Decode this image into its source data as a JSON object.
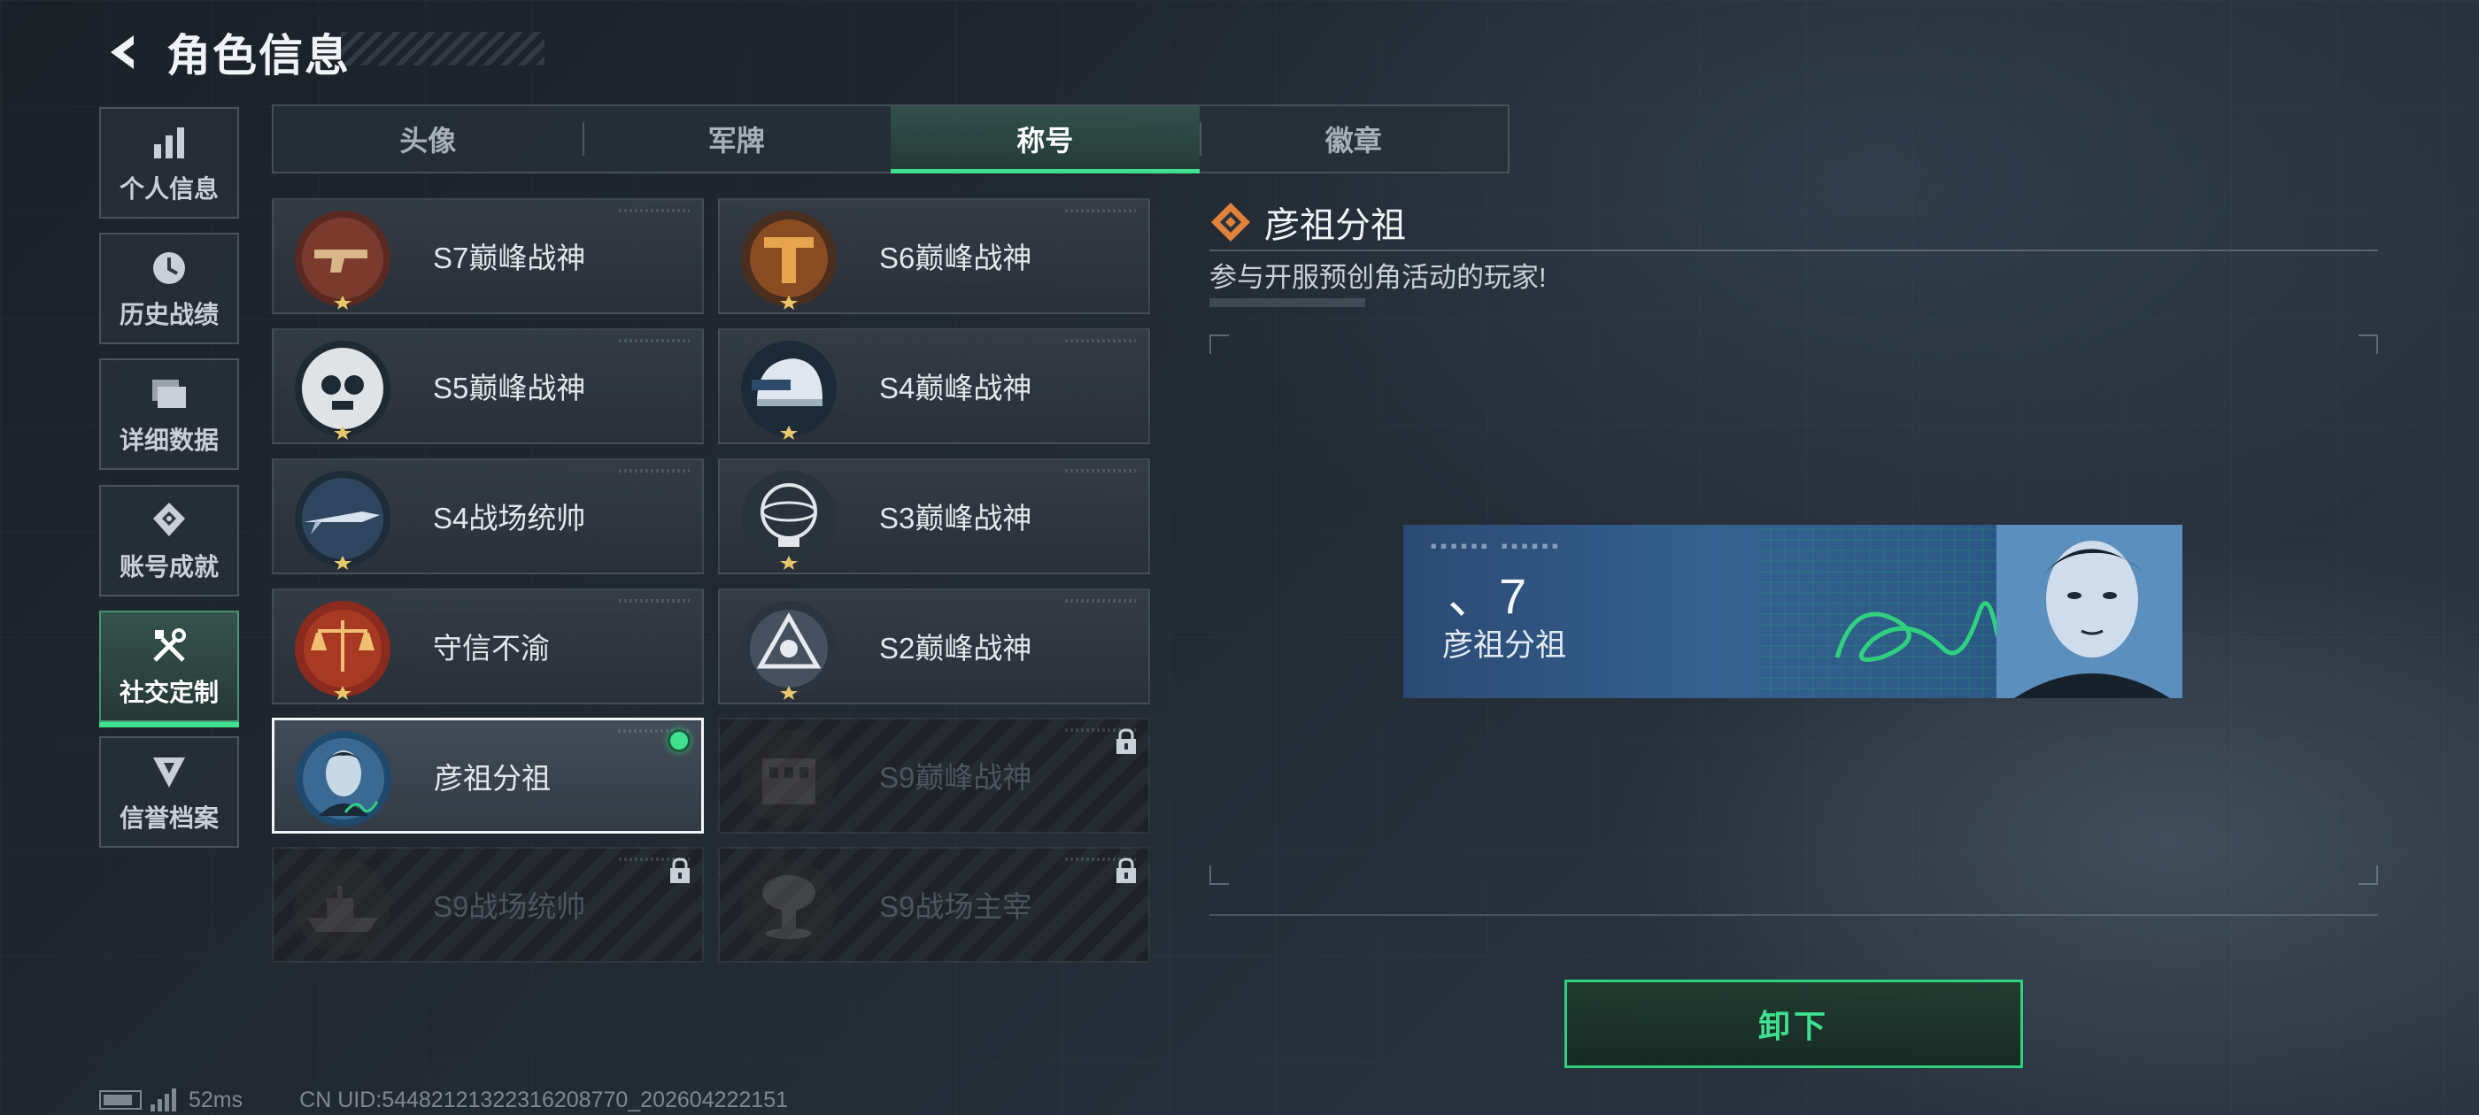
{
  "header": {
    "title": "角色信息"
  },
  "sidebar": {
    "items": [
      {
        "label": "个人信息",
        "icon": "bar-chart-icon",
        "active": false
      },
      {
        "label": "历史战绩",
        "icon": "clock-icon",
        "active": false
      },
      {
        "label": "详细数据",
        "icon": "folder-icon",
        "active": false
      },
      {
        "label": "账号成就",
        "icon": "achievement-icon",
        "active": false
      },
      {
        "label": "社交定制",
        "icon": "tools-icon",
        "active": true
      },
      {
        "label": "信誉档案",
        "icon": "shield-icon",
        "active": false
      }
    ]
  },
  "tabs": [
    {
      "label": "头像",
      "active": false
    },
    {
      "label": "军牌",
      "active": false
    },
    {
      "label": "称号",
      "active": true
    },
    {
      "label": "徽章",
      "active": false
    }
  ],
  "titles": [
    {
      "label": "S7巅峰战神",
      "state": "normal",
      "icon": "pistol-emblem-icon"
    },
    {
      "label": "S6巅峰战神",
      "state": "normal",
      "icon": "bronze-t-emblem-icon"
    },
    {
      "label": "S5巅峰战神",
      "state": "normal",
      "icon": "skull-emblem-icon"
    },
    {
      "label": "S4巅峰战神",
      "state": "normal",
      "icon": "helmet-emblem-icon"
    },
    {
      "label": "S4战场统帅",
      "state": "normal",
      "icon": "missile-emblem-icon"
    },
    {
      "label": "S3巅峰战神",
      "state": "normal",
      "icon": "globe-emblem-icon"
    },
    {
      "label": "守信不渝",
      "state": "normal",
      "icon": "scales-emblem-icon"
    },
    {
      "label": "S2巅峰战神",
      "state": "normal",
      "icon": "triangle-emblem-icon"
    },
    {
      "label": "彦祖分祖",
      "state": "selected",
      "icon": "portrait-emblem-icon"
    },
    {
      "label": "S9巅峰战神",
      "state": "locked",
      "icon": "building-emblem-icon"
    },
    {
      "label": "S9战场统帅",
      "state": "locked",
      "icon": "warship-emblem-icon"
    },
    {
      "label": "S9战场主宰",
      "state": "locked",
      "icon": "mushroom-cloud-emblem-icon"
    }
  ],
  "detail": {
    "title": "彦祖分祖",
    "description": "参与开服预创角活动的玩家!",
    "preview": {
      "season": "、7",
      "name": "彦祖分祖"
    },
    "unequip_label": "卸下"
  },
  "status": {
    "latency": "52ms",
    "uid": "CN UID:544821213223​16208770_202604222151"
  },
  "colors": {
    "accent": "#3fe08f",
    "locked_text": "#4d555e",
    "background": "#222a33"
  }
}
